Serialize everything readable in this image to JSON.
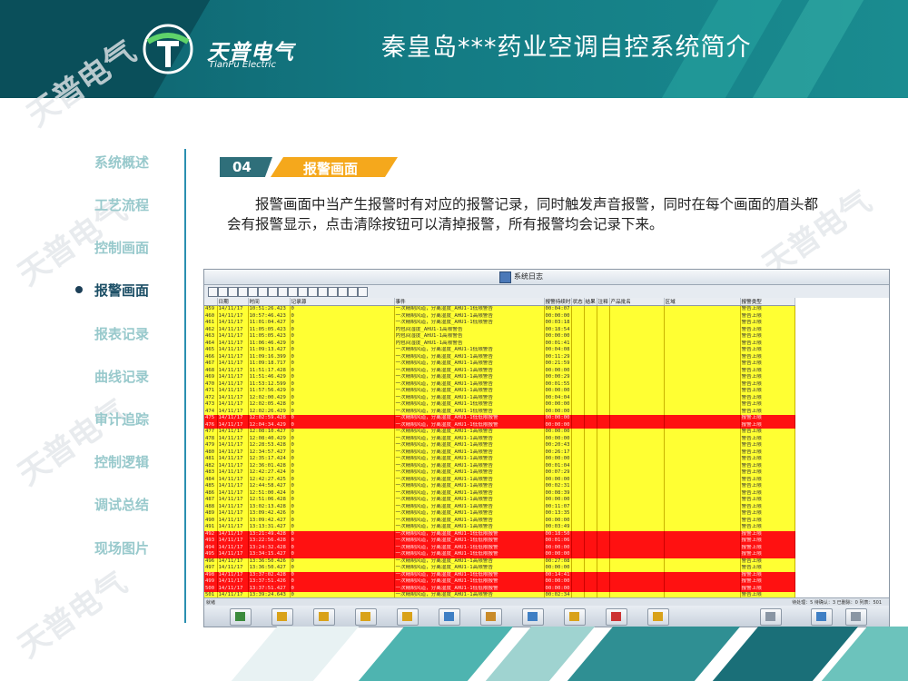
{
  "brand": {
    "name_cn": "天普电气",
    "name_en": "TianPu Electric"
  },
  "page_title": "秦皇岛***药业空调自控系统简介",
  "watermark": "天普电气",
  "colors": {
    "header": "#13707a",
    "accent_orange": "#f5a81c",
    "nav_inactive": "#98c9cc",
    "nav_active": "#1c4f66",
    "alarm_yellow": "#ffff33",
    "alarm_red": "#ff1111"
  },
  "nav": {
    "items": [
      {
        "label": "系统概述"
      },
      {
        "label": "工艺流程"
      },
      {
        "label": "控制画面"
      },
      {
        "label": "报警画面",
        "active": true
      },
      {
        "label": "报表记录"
      },
      {
        "label": "曲线记录"
      },
      {
        "label": "审计追踪"
      },
      {
        "label": "控制逻辑"
      },
      {
        "label": "调试总结"
      },
      {
        "label": "现场图片"
      }
    ]
  },
  "section": {
    "number": "04",
    "title": "报警画面"
  },
  "paragraph": "报警画面中当产生报警时有对应的报警记录，同时触发声音报警，同时在每个画面的眉头都会有报警显示，点击清除按钮可以清掉报警，所有报警均会记录下来。",
  "screenshot": {
    "window_title": "系统日志",
    "columns": [
      "",
      "日期",
      "时间",
      "记录源",
      "事件",
      "报警持续时间",
      "状态",
      "结果",
      "注释",
      "产品批名",
      "区域",
      "报警类型"
    ],
    "status_left": "就绪",
    "status_right": "待处理：5  待确认：3  已删除：0  列表：501",
    "rows": [
      {
        "id": "459",
        "date": "14/11/17",
        "time": "10:51:26.423",
        "src": "0",
        "event": "一次精制风道，分离湿度_AHU1-1低限警告",
        "dur": "00:04:07",
        "state": "y",
        "type": "警告上限"
      },
      {
        "id": "460",
        "date": "14/11/17",
        "time": "10:57:46.423",
        "src": "0",
        "event": "一次精制风道，分离湿度_AHU1-1高限警告",
        "dur": "00:00:00",
        "state": "y",
        "type": "警告上限"
      },
      {
        "id": "461",
        "date": "14/11/17",
        "time": "11:01:04.427",
        "src": "0",
        "event": "一次精制风道，分离湿度_AHU1-1低限警告",
        "dur": "00:03:18",
        "state": "y",
        "type": "警告上限"
      },
      {
        "id": "462",
        "date": "14/11/17",
        "time": "11:05:05.423",
        "src": "0",
        "event": "内包间湿度_AHU1-1高限警告",
        "dur": "00:18:54",
        "state": "y",
        "type": "警告上限"
      },
      {
        "id": "463",
        "date": "14/11/17",
        "time": "11:05:05.423",
        "src": "0",
        "event": "内包间湿度_AHU1-1高限警告",
        "dur": "00:00:00",
        "state": "y",
        "type": "警告上限"
      },
      {
        "id": "464",
        "date": "14/11/17",
        "time": "11:06:46.429",
        "src": "0",
        "event": "内包间湿度_AHU1-1高限警告",
        "dur": "00:01:41",
        "state": "y",
        "type": "警告上限"
      },
      {
        "id": "465",
        "date": "14/11/17",
        "time": "11:09:13.427",
        "src": "0",
        "event": "一次精制风道，分离湿度_AHU1-1低限警告",
        "dur": "00:04:08",
        "state": "y",
        "type": "警告上限"
      },
      {
        "id": "466",
        "date": "14/11/17",
        "time": "11:09:16.399",
        "src": "0",
        "event": "一次精制风道，分离湿度_AHU1-1高限警告",
        "dur": "00:11:29",
        "state": "y",
        "type": "警告上限"
      },
      {
        "id": "467",
        "date": "14/11/17",
        "time": "11:09:18.717",
        "src": "0",
        "event": "一次精制风道，分离湿度_AHU1-1高限警告",
        "dur": "00:21:59",
        "state": "y",
        "type": "警告上限"
      },
      {
        "id": "468",
        "date": "14/11/17",
        "time": "11:51:17.428",
        "src": "0",
        "event": "一次精制风道，分离湿度_AHU1-1高限警告",
        "dur": "00:00:00",
        "state": "y",
        "type": "警告上限"
      },
      {
        "id": "469",
        "date": "14/11/17",
        "time": "11:51:46.429",
        "src": "0",
        "event": "一次精制风道，分离湿度_AHU1-1高限警告",
        "dur": "00:00:29",
        "state": "y",
        "type": "警告上限"
      },
      {
        "id": "470",
        "date": "14/11/17",
        "time": "11:53:12.599",
        "src": "0",
        "event": "一次精制风道，分离湿度_AHU1-1高限警告",
        "dur": "00:01:55",
        "state": "y",
        "type": "警告上限"
      },
      {
        "id": "471",
        "date": "14/11/17",
        "time": "11:57:56.429",
        "src": "0",
        "event": "一次精制风道，分离湿度_AHU1-1高限警告",
        "dur": "00:00:00",
        "state": "y",
        "type": "警告上限"
      },
      {
        "id": "472",
        "date": "14/11/17",
        "time": "12:02:00.429",
        "src": "0",
        "event": "一次精制风道，分离湿度_AHU1-1高限警告",
        "dur": "00:04:04",
        "state": "y",
        "type": "警告上限"
      },
      {
        "id": "473",
        "date": "14/11/17",
        "time": "12:02:05.428",
        "src": "0",
        "event": "一次精制风道，分离湿度_AHU1-1低限警告",
        "dur": "00:00:00",
        "state": "y",
        "type": "警告上限"
      },
      {
        "id": "474",
        "date": "14/11/17",
        "time": "12:02:26.429",
        "src": "0",
        "event": "一次精制风道，分离湿度_AHU1-1低限警告",
        "dur": "00:00:00",
        "state": "y",
        "type": "警告上限"
      },
      {
        "id": "475",
        "date": "14/11/17",
        "time": "12:02:59.428",
        "src": "0",
        "event": "一次精制风道，分离湿度_AHU1-1低低限报警",
        "dur": "00:00:00",
        "state": "r",
        "type": "报警上限"
      },
      {
        "id": "476",
        "date": "14/11/17",
        "time": "12:04:34.429",
        "src": "0",
        "event": "一次精制风道，分离湿度_AHU1-1低低限报警",
        "dur": "00:00:00",
        "state": "r",
        "type": "报警上限"
      },
      {
        "id": "477",
        "date": "14/11/17",
        "time": "12:08:10.427",
        "src": "0",
        "event": "一次精制风道，分离湿度_AHU1-1高限警告",
        "dur": "00:00:00",
        "state": "y",
        "type": "警告上限"
      },
      {
        "id": "478",
        "date": "14/11/17",
        "time": "12:08:40.429",
        "src": "0",
        "event": "一次精制风道，分离湿度_AHU1-1高限警告",
        "dur": "00:00:00",
        "state": "y",
        "type": "警告上限"
      },
      {
        "id": "479",
        "date": "14/11/17",
        "time": "12:28:53.428",
        "src": "0",
        "event": "一次精制风道，分离湿度_AHU1-1高限警告",
        "dur": "00:20:43",
        "state": "y",
        "type": "警告上限"
      },
      {
        "id": "480",
        "date": "14/11/17",
        "time": "12:34:57.427",
        "src": "0",
        "event": "一次精制风道，分离湿度_AHU1-1高限警告",
        "dur": "00:26:17",
        "state": "y",
        "type": "警告上限"
      },
      {
        "id": "481",
        "date": "14/11/17",
        "time": "12:35:17.424",
        "src": "0",
        "event": "一次精制风道，分离湿度_AHU1-1高限警告",
        "dur": "00:00:00",
        "state": "y",
        "type": "警告上限"
      },
      {
        "id": "482",
        "date": "14/11/17",
        "time": "12:36:01.428",
        "src": "0",
        "event": "一次精制风道，分离湿度_AHU1-1高限警告",
        "dur": "00:01:04",
        "state": "y",
        "type": "警告上限"
      },
      {
        "id": "483",
        "date": "14/11/17",
        "time": "12:42:27.424",
        "src": "0",
        "event": "一次精制风道，分离湿度_AHU1-1高限警告",
        "dur": "00:07:29",
        "state": "y",
        "type": "警告上限"
      },
      {
        "id": "484",
        "date": "14/11/17",
        "time": "12:42:27.425",
        "src": "0",
        "event": "一次精制风道，分离湿度_AHU1-1高限警告",
        "dur": "00:00:00",
        "state": "y",
        "type": "警告上限"
      },
      {
        "id": "485",
        "date": "14/11/17",
        "time": "12:44:58.427",
        "src": "0",
        "event": "一次精制风道，分离湿度_AHU1-1高限警告",
        "dur": "00:02:31",
        "state": "y",
        "type": "警告上限"
      },
      {
        "id": "486",
        "date": "14/11/17",
        "time": "12:51:00.424",
        "src": "0",
        "event": "一次精制风道，分离湿度_AHU1-1高限警告",
        "dur": "00:08:39",
        "state": "y",
        "type": "警告上限"
      },
      {
        "id": "487",
        "date": "14/11/17",
        "time": "12:51:06.428",
        "src": "0",
        "event": "一次精制风道，分离湿度_AHU1-1高限警告",
        "dur": "00:00:00",
        "state": "y",
        "type": "警告上限"
      },
      {
        "id": "488",
        "date": "14/11/17",
        "time": "13:02:13.428",
        "src": "0",
        "event": "一次精制风道，分离湿度_AHU1-1高限警告",
        "dur": "00:11:07",
        "state": "y",
        "type": "警告上限"
      },
      {
        "id": "489",
        "date": "14/11/17",
        "time": "13:09:42.426",
        "src": "0",
        "event": "一次精制风道，分离湿度_AHU1-1高限警告",
        "dur": "00:13:35",
        "state": "y",
        "type": "警告上限"
      },
      {
        "id": "490",
        "date": "14/11/17",
        "time": "13:09:42.427",
        "src": "0",
        "event": "一次精制风道，分离湿度_AHU1-1高限警告",
        "dur": "00:00:00",
        "state": "y",
        "type": "警告上限"
      },
      {
        "id": "491",
        "date": "14/11/17",
        "time": "13:13:31.427",
        "src": "0",
        "event": "一次精制风道，分离湿度_AHU1-1高限警告",
        "dur": "00:03:49",
        "state": "y",
        "type": "警告上限"
      },
      {
        "id": "492",
        "date": "14/11/17",
        "time": "13:21:49.428",
        "src": "0",
        "event": "一次精制风道，分离湿度_AHU1-1低低限报警",
        "dur": "00:18:50",
        "state": "r",
        "type": "报警上限"
      },
      {
        "id": "493",
        "date": "14/11/17",
        "time": "13:22:56.428",
        "src": "0",
        "event": "一次精制风道，分离湿度_AHU1-1低低限报警",
        "dur": "00:01:06",
        "state": "r",
        "type": "报警上限"
      },
      {
        "id": "494",
        "date": "14/11/17",
        "time": "13:24:32.428",
        "src": "0",
        "event": "一次精制风道，分离湿度_AHU1-1低低限报警",
        "dur": "00:00:00",
        "state": "r",
        "type": "报警上限"
      },
      {
        "id": "495",
        "date": "14/11/17",
        "time": "13:34:15.427",
        "src": "0",
        "event": "一次精制风道，分离湿度_AHU1-1低低限报警",
        "dur": "00:00:00",
        "state": "r",
        "type": "报警上限"
      },
      {
        "id": "496",
        "date": "14/11/17",
        "time": "13:36:50.426",
        "src": "0",
        "event": "一次精制风道，分离湿度_AHU1-1高限警告",
        "dur": "00:27:08",
        "state": "y",
        "type": "警告上限"
      },
      {
        "id": "497",
        "date": "14/11/17",
        "time": "13:36:50.427",
        "src": "0",
        "event": "一次精制风道，分离湿度_AHU1-1高限警告",
        "dur": "00:00:00",
        "state": "y",
        "type": "警告上限"
      },
      {
        "id": "498",
        "date": "14/11/17",
        "time": "13:37:02.428",
        "src": "0",
        "event": "一次精制风道，分离湿度_AHU1-1低低限报警",
        "dur": "00:14:41",
        "state": "r",
        "type": "报警上限"
      },
      {
        "id": "499",
        "date": "14/11/17",
        "time": "13:37:51.426",
        "src": "0",
        "event": "一次精制风道，分离湿度_AHU1-1低低限报警",
        "dur": "00:00:00",
        "state": "r",
        "type": "报警上限"
      },
      {
        "id": "500",
        "date": "14/11/17",
        "time": "13:37:51.427",
        "src": "0",
        "event": "一次精制风道，分离湿度_AHU1-1低低限报警",
        "dur": "00:00:00",
        "state": "r",
        "type": "报警上限"
      },
      {
        "id": "501",
        "date": "14/11/17",
        "time": "13:39:24.643",
        "src": "0",
        "event": "一次精制风道，分离湿度_AHU1-1高限警告",
        "dur": "00:02:34",
        "state": "y",
        "type": "警告上限"
      }
    ]
  }
}
